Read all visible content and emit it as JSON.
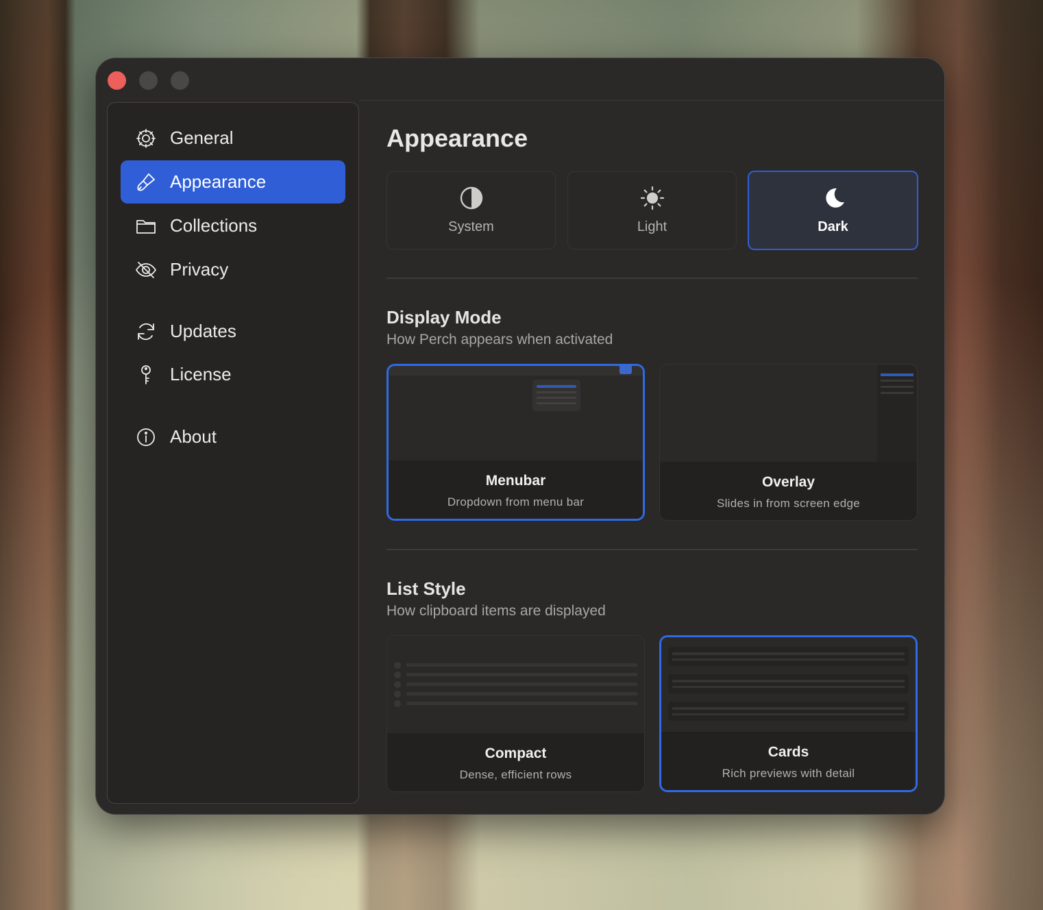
{
  "sidebar": {
    "items": [
      {
        "label": "General",
        "icon": "gear-icon"
      },
      {
        "label": "Appearance",
        "icon": "paintbrush-icon",
        "active": true
      },
      {
        "label": "Collections",
        "icon": "folder-icon"
      },
      {
        "label": "Privacy",
        "icon": "eye-slash-icon"
      },
      {
        "label": "Updates",
        "icon": "refresh-icon"
      },
      {
        "label": "License",
        "icon": "key-icon"
      },
      {
        "label": "About",
        "icon": "info-icon"
      }
    ]
  },
  "main": {
    "title": "Appearance",
    "theme_options": [
      {
        "label": "System",
        "icon": "half-circle-icon"
      },
      {
        "label": "Light",
        "icon": "sun-icon"
      },
      {
        "label": "Dark",
        "icon": "moon-icon",
        "selected": true
      }
    ],
    "display_mode": {
      "title": "Display Mode",
      "subtitle": "How Perch appears when activated",
      "options": [
        {
          "title": "Menubar",
          "subtitle": "Dropdown from menu bar",
          "selected": true
        },
        {
          "title": "Overlay",
          "subtitle": "Slides in from screen edge"
        }
      ]
    },
    "list_style": {
      "title": "List Style",
      "subtitle": "How clipboard items are displayed",
      "options": [
        {
          "title": "Compact",
          "subtitle": "Dense, efficient rows"
        },
        {
          "title": "Cards",
          "subtitle": "Rich previews with detail",
          "selected": true
        }
      ]
    }
  },
  "colors": {
    "accent": "#2f5ed6",
    "window_bg": "#2b2928",
    "close_button": "#ed5f5a"
  }
}
